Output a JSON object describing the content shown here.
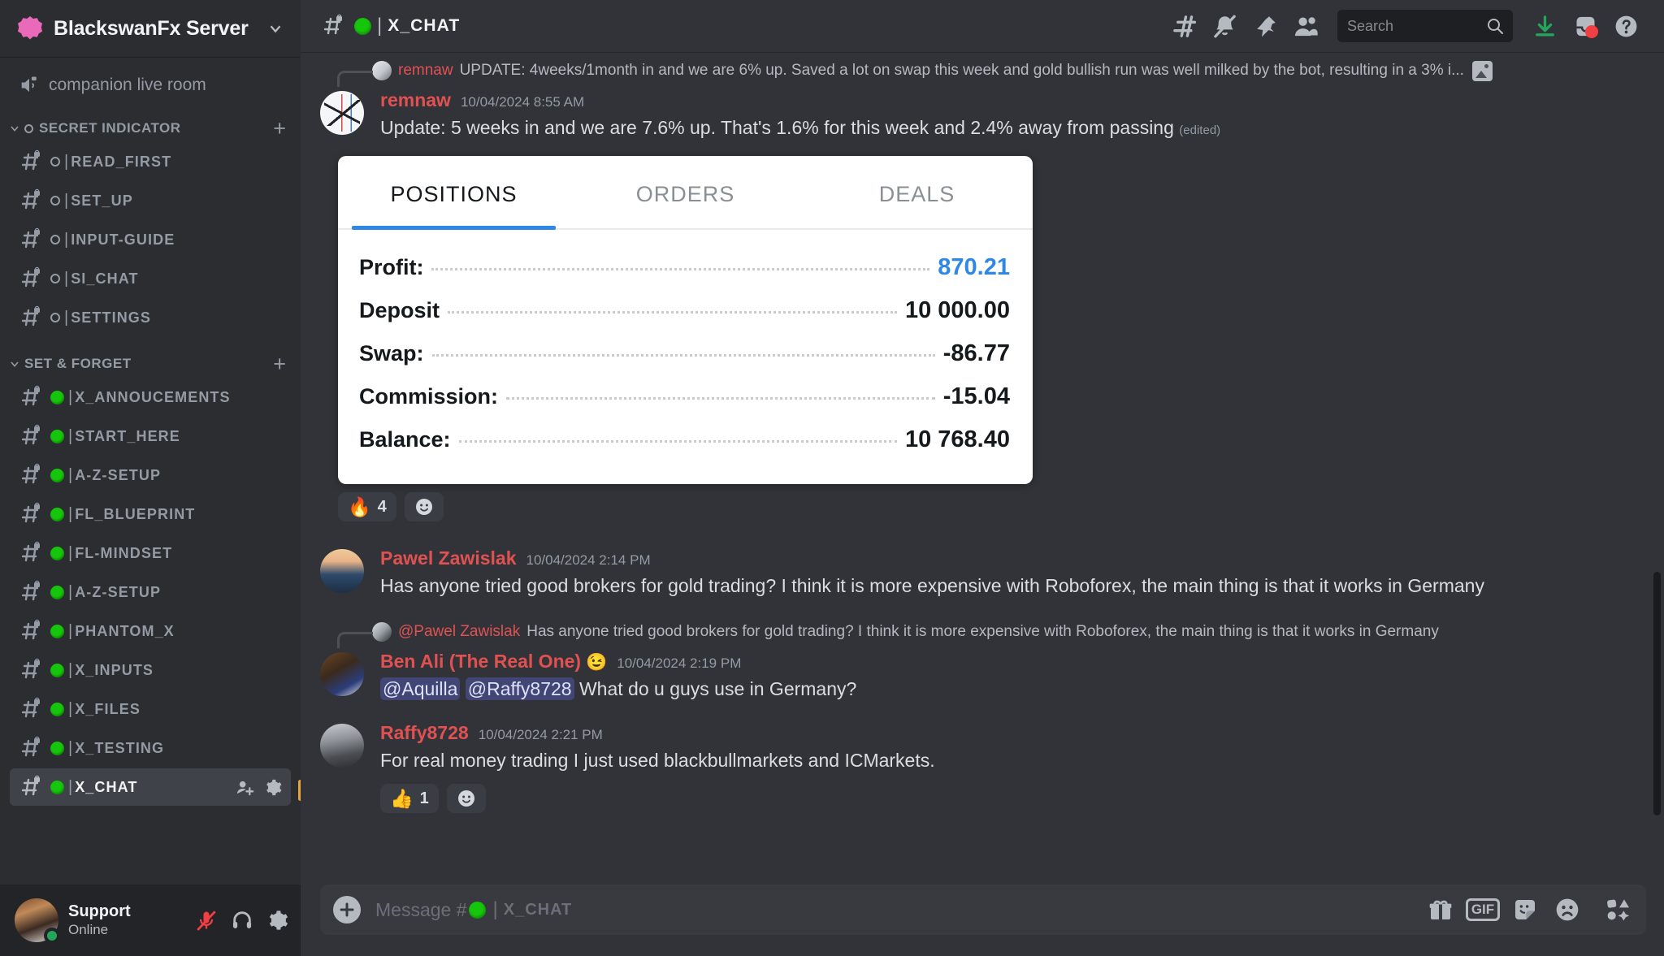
{
  "server": {
    "name": "BlackswanFx Server",
    "icon": "home-icon",
    "dropdown_icon": "chevron-down-icon"
  },
  "voice": {
    "label": "companion live room",
    "icon": "speaker-locked-icon"
  },
  "categories": [
    {
      "label": "SECRET INDICATOR",
      "add_label": "+",
      "marker": "circle-outline",
      "channels": [
        {
          "name": "READ_FIRST",
          "marker": "circle-outline"
        },
        {
          "name": "SET_UP",
          "marker": "circle-outline"
        },
        {
          "name": "INPUT-GUIDE",
          "marker": "circle-outline"
        },
        {
          "name": "SI_CHAT",
          "marker": "circle-outline"
        },
        {
          "name": "SETTINGS",
          "marker": "circle-outline"
        }
      ]
    },
    {
      "label": "SET & FORGET",
      "add_label": "+",
      "marker": "none",
      "channels": [
        {
          "name": "X_ANNOUCEMENTS",
          "marker": "green-dot"
        },
        {
          "name": "START_HERE",
          "marker": "green-dot"
        },
        {
          "name": "A-Z-SETUP",
          "marker": "green-dot"
        },
        {
          "name": "FL_BLUEPRINT",
          "marker": "green-dot"
        },
        {
          "name": "FL-MINDSET",
          "marker": "green-dot"
        },
        {
          "name": "A-Z-SETUP",
          "marker": "green-dot"
        },
        {
          "name": "PHANTOM_X",
          "marker": "green-dot"
        },
        {
          "name": "X_INPUTS",
          "marker": "green-dot"
        },
        {
          "name": "X_FILES",
          "marker": "green-dot"
        },
        {
          "name": "X_TESTING",
          "marker": "green-dot"
        },
        {
          "name": "X_CHAT",
          "marker": "green-dot",
          "active": true
        }
      ]
    }
  ],
  "user": {
    "name": "Support",
    "status": "Online",
    "icons": [
      "mic-muted-icon",
      "headset-icon",
      "gear-icon"
    ]
  },
  "topbar": {
    "channel_name": "X_CHAT",
    "icons": [
      "threads-icon",
      "bell-muted-icon",
      "pin-icon",
      "members-icon"
    ],
    "right_icons": [
      "download-icon",
      "inbox-icon",
      "help-icon"
    ]
  },
  "search": {
    "placeholder": "Search",
    "value": "",
    "icon": "search-icon"
  },
  "messages": [
    {
      "type": "reply-context",
      "author": "remnaw",
      "text": "UPDATE: 4weeks/1month in and we are 6% up. Saved a lot on swap this week and gold bullish run was well milked by the bot, resulting in a 3% i...",
      "attachment_icon": "image-icon"
    },
    {
      "type": "message",
      "author": "remnaw",
      "timestamp": "10/04/2024 8:55 AM",
      "text": "Update: 5 weeks in and we are 7.6% up. That's 1.6% for this week and 2.4% away from passing",
      "edited_label": "(edited)",
      "avatar": "chart-avatar",
      "card": {
        "tabs": [
          {
            "label": "POSITIONS",
            "active": true
          },
          {
            "label": "ORDERS",
            "active": false
          },
          {
            "label": "DEALS",
            "active": false
          }
        ],
        "rows": [
          {
            "label": "Profit:",
            "value": "870.21",
            "highlight": true
          },
          {
            "label": "Deposit",
            "value": "10 000.00",
            "highlight": false
          },
          {
            "label": "Swap:",
            "value": "-86.77",
            "highlight": false
          },
          {
            "label": "Commission:",
            "value": "-15.04",
            "highlight": false
          },
          {
            "label": "Balance:",
            "value": "10 768.40",
            "highlight": false
          }
        ]
      },
      "reactions": [
        {
          "emoji": "🔥",
          "count": "4"
        }
      ],
      "add_reaction_icon": "add-reaction-icon"
    },
    {
      "type": "message",
      "author": "Pawel Zawislak",
      "timestamp": "10/04/2024 2:14 PM",
      "text": "Has anyone tried good brokers for gold trading? I think it is more expensive with Roboforex, the main thing is that it works in Germany",
      "avatar": "pawel-avatar"
    },
    {
      "type": "reply-context",
      "author": "@Pawel Zawislak",
      "text": "Has anyone tried good brokers for gold trading? I think it is more expensive with Roboforex, the main thing is that it works in Germany"
    },
    {
      "type": "message",
      "author": "Ben Ali (The Real One)",
      "author_emoji": "😉",
      "timestamp": "10/04/2024 2:19 PM",
      "mentions": [
        "@Aquilla",
        "@Raffy8728"
      ],
      "text": "What do u guys use in Germany?",
      "avatar": "ben-avatar"
    },
    {
      "type": "message",
      "author": "Raffy8728",
      "timestamp": "10/04/2024 2:21 PM",
      "text": "For real money trading I just used blackbullmarkets and ICMarkets.",
      "avatar": "raffy-avatar",
      "reactions": [
        {
          "emoji": "👍",
          "count": "1"
        }
      ],
      "add_reaction_icon": "add-reaction-icon"
    }
  ],
  "composer": {
    "placeholder_prefix": "Message #",
    "channel_name": "X_CHAT",
    "plus_icon": "plus-icon",
    "icons": [
      "gift-icon",
      "gif-icon",
      "sticker-icon",
      "emoji-icon",
      "apps-icon"
    ],
    "gif_label": "GIF"
  },
  "colors": {
    "sidebar_bg": "#2b2d31",
    "main_bg": "#313338",
    "user_panel_bg": "#232428",
    "accent_blue": "#2f87e8",
    "author_red": "#e05252",
    "green_dot": "#16c60c",
    "mention_bg": "#414675",
    "unread_bar": "#e8a33d"
  }
}
